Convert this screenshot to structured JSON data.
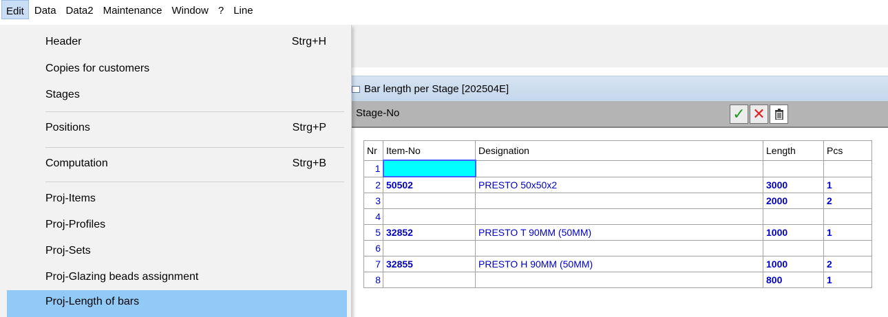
{
  "menubar": {
    "items": [
      {
        "label": "Edit"
      },
      {
        "label": "Data"
      },
      {
        "label": "Data2"
      },
      {
        "label": "Maintenance"
      },
      {
        "label": "Window"
      },
      {
        "label": "?"
      },
      {
        "label": "Line"
      }
    ]
  },
  "edit_menu": {
    "items": [
      {
        "label": "Header",
        "shortcut": "Strg+H"
      },
      {
        "label": "Copies for customers",
        "shortcut": ""
      },
      {
        "label": "Stages",
        "shortcut": ""
      },
      {
        "label": "Positions",
        "shortcut": "Strg+P"
      },
      {
        "label": "Computation",
        "shortcut": "Strg+B"
      },
      {
        "label": "Proj-Items",
        "shortcut": ""
      },
      {
        "label": "Proj-Profiles",
        "shortcut": ""
      },
      {
        "label": "Proj-Sets",
        "shortcut": ""
      },
      {
        "label": "Proj-Glazing beads assignment",
        "shortcut": ""
      },
      {
        "label": "Proj-Length of bars",
        "shortcut": ""
      }
    ]
  },
  "child_window": {
    "title": "Bar length per Stage [202504E]",
    "stage_label": "Stage-No",
    "buttons": {
      "ok": "✓",
      "cancel": "✕",
      "delete": "🗑"
    }
  },
  "grid": {
    "columns": [
      "Nr",
      "Item-No",
      "Designation",
      "Length",
      "Pcs"
    ],
    "rows": [
      {
        "nr": "1",
        "item": "",
        "designation": "",
        "length": "",
        "pcs": ""
      },
      {
        "nr": "2",
        "item": "50502",
        "designation": "PRESTO 50x50x2",
        "length": "3000",
        "pcs": "1"
      },
      {
        "nr": "3",
        "item": "",
        "designation": "",
        "length": "2000",
        "pcs": "2"
      },
      {
        "nr": "4",
        "item": "",
        "designation": "",
        "length": "",
        "pcs": ""
      },
      {
        "nr": "5",
        "item": "32852",
        "designation": "PRESTO T 90MM (50MM)",
        "length": "1000",
        "pcs": "1"
      },
      {
        "nr": "6",
        "item": "",
        "designation": "",
        "length": "",
        "pcs": ""
      },
      {
        "nr": "7",
        "item": "32855",
        "designation": "PRESTO H 90MM (50MM)",
        "length": "1000",
        "pcs": "2"
      },
      {
        "nr": "8",
        "item": "",
        "designation": "",
        "length": "800",
        "pcs": "1"
      }
    ]
  },
  "colors": {
    "menu_highlight": "#91c9f7",
    "selected_cell": "#00ffff",
    "grid_text": "#0000c0"
  }
}
